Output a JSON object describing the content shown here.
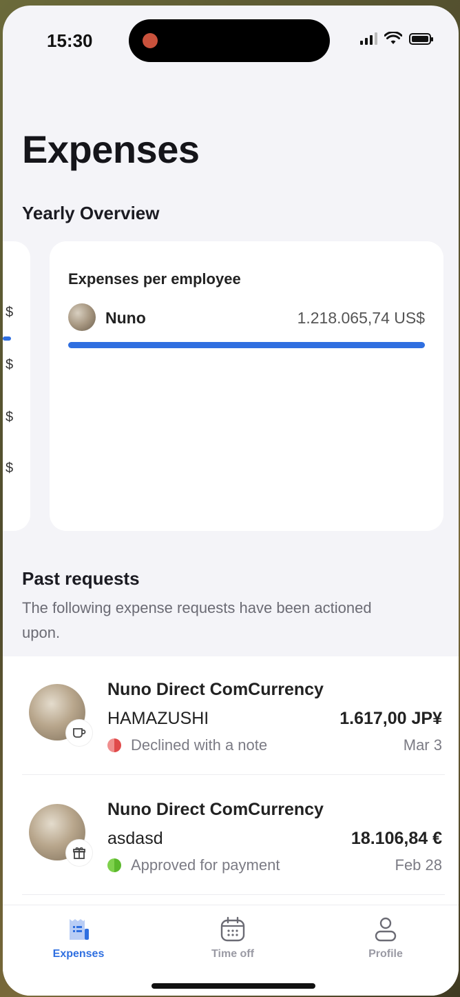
{
  "status_bar": {
    "time": "15:30"
  },
  "page": {
    "title": "Expenses"
  },
  "overview": {
    "section_title": "Yearly Overview",
    "prev_card_labels": [
      "$",
      "$",
      "$",
      "$"
    ],
    "card": {
      "title": "Expenses per employee",
      "employees": [
        {
          "name": "Nuno",
          "amount": "1.218.065,74 US$",
          "share": 1.0
        }
      ]
    }
  },
  "past_requests": {
    "title": "Past requests",
    "subtitle": "The following expense requests have been actioned upon.",
    "items": [
      {
        "company": "Nuno Direct ComCurrency",
        "vendor": "HAMAZUSHI",
        "amount": "1.617,00 JP¥",
        "status": "Declined with a note",
        "status_color": "#e04a4a",
        "date": "Mar 3",
        "category_icon": "coffee-icon"
      },
      {
        "company": "Nuno Direct ComCurrency",
        "vendor": "asdasd",
        "amount": "18.106,84 €",
        "status": "Approved for payment",
        "status_color": "#5bb82c",
        "date": "Feb 28",
        "category_icon": "gift-icon"
      }
    ]
  },
  "tabbar": {
    "tabs": [
      {
        "label": "Expenses",
        "icon": "receipt-icon",
        "active": true
      },
      {
        "label": "Time off",
        "icon": "calendar-icon",
        "active": false
      },
      {
        "label": "Profile",
        "icon": "person-icon",
        "active": false
      }
    ]
  },
  "colors": {
    "accent": "#2f6fe0",
    "background": "#f4f4f8"
  }
}
